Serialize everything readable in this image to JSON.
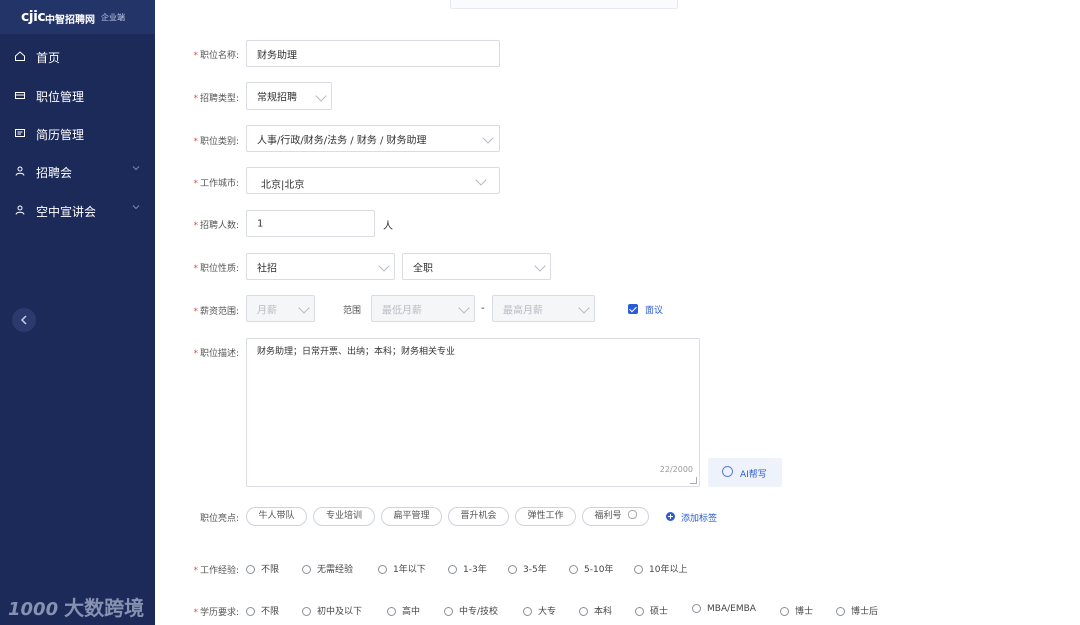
{
  "sidebar": {
    "logo_mark": "cjic",
    "logo_name": "中智招聘网",
    "logo_sub": "企业端",
    "items": [
      {
        "label": "首页",
        "icon": "home-icon"
      },
      {
        "label": "职位管理",
        "icon": "briefcase-icon"
      },
      {
        "label": "简历管理",
        "icon": "resume-icon"
      },
      {
        "label": "招聘会",
        "icon": "person-icon",
        "has_submenu": true
      },
      {
        "label": "空中宣讲会",
        "icon": "person-icon",
        "has_submenu": true
      }
    ]
  },
  "watermark": {
    "digits": "1000",
    "text": "大数跨境"
  },
  "form": {
    "job_name": {
      "label": "职位名称:",
      "value": "财务助理"
    },
    "recruit_type": {
      "label": "招聘类型:",
      "value": "常规招聘"
    },
    "job_category": {
      "label": "职位类别:",
      "value": "人事/行政/财务/法务 / 财务 / 财务助理"
    },
    "work_city": {
      "label": "工作城市:",
      "value": "北京|北京"
    },
    "headcount": {
      "label": "招聘人数:",
      "value": "1",
      "unit": "人"
    },
    "job_nature": {
      "label": "职位性质:",
      "value1": "社招",
      "value2": "全职"
    },
    "salary": {
      "label": "薪资范围:",
      "period_placeholder": "月薪",
      "range_label": "范围",
      "min_placeholder": "最低月薪",
      "separator": "-",
      "max_placeholder": "最高月薪",
      "negotiable_label": "面议",
      "negotiable_checked": true
    },
    "description": {
      "label": "职位描述:",
      "value": "财务助理；日常开票、出纳；本科；财务相关专业",
      "count": "22/2000",
      "ai_button": "AI帮写"
    },
    "highlights": {
      "label": "职位亮点:",
      "tags": [
        "牛人带队",
        "专业培训",
        "扁平管理",
        "晋升机会",
        "弹性工作",
        "福利号"
      ],
      "add_label": "添加标签"
    },
    "experience": {
      "label": "工作经验:",
      "options": [
        "不限",
        "无需经验",
        "1年以下",
        "1-3年",
        "3-5年",
        "5-10年",
        "10年以上"
      ]
    },
    "education": {
      "label": "学历要求:",
      "options": [
        "不限",
        "初中及以下",
        "高中",
        "中专/技校",
        "大专",
        "本科",
        "硕士",
        "MBA/EMBA",
        "博士",
        "博士后"
      ]
    }
  }
}
